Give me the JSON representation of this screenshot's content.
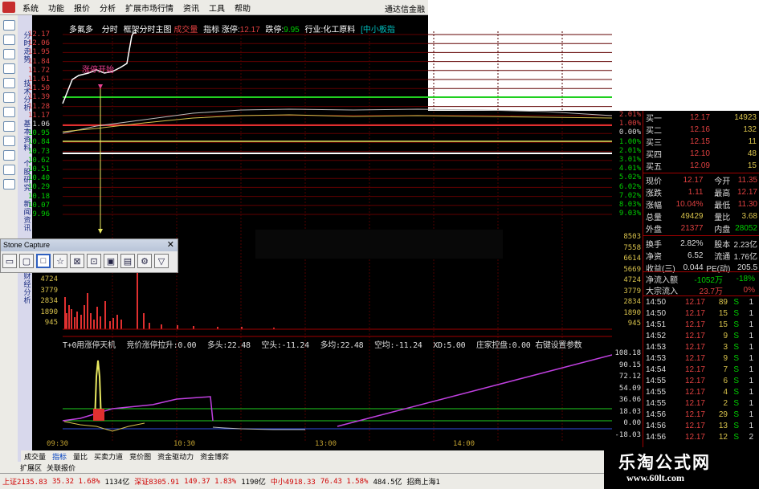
{
  "menu": {
    "items": [
      "系统",
      "功能",
      "报价",
      "分析",
      "扩展市场行情",
      "资讯",
      "工具",
      "帮助"
    ],
    "app_title": "通达信金融"
  },
  "left_tabs": [
    "分时走势",
    "技术分析",
    "基本资料",
    "个股研究",
    "新闻资讯",
    "财经分析"
  ],
  "header": {
    "stock": "多氟多",
    "view": "分时",
    "frame": "框架分时主图",
    "vol_label": "成交量",
    "ind": "指标",
    "limit_up_label": "涨停:",
    "limit_up": "12.17",
    "limit_down_label": "跌停:",
    "limit_down": "9.95",
    "industry": "行业:化工原料",
    "board": "[中小板指"
  },
  "note": "涨停开始",
  "price_axis": [
    "12.17",
    "12.06",
    "11.95",
    "11.84",
    "11.72",
    "11.61",
    "11.50",
    "11.39",
    "11.28",
    "11.17",
    "11.06",
    "10.95",
    "10.84",
    "10.73",
    "10.62",
    "10.51",
    "10.40",
    "10.29",
    "10.18",
    "10.07",
    "9.96"
  ],
  "pct_axis": [
    "2.01%",
    "1.00%",
    "0.00%",
    "1.00%",
    "2.01%",
    "3.01%",
    "4.01%",
    "5.02%",
    "6.02%",
    "7.02%",
    "8.03%",
    "9.03%"
  ],
  "vol_axis": [
    "8503",
    "7558",
    "6614",
    "5669",
    "4724",
    "3779",
    "2834",
    "1890",
    "945"
  ],
  "ind_header": {
    "name": "T+0用涨停天机",
    "items": [
      "竞价涨停拉升:0.00",
      "多头:22.48",
      "空头:-11.24",
      "多均:22.48",
      "空均:-11.24",
      "XD:5.00",
      "庄家控盘:0.00",
      "右键设置参数"
    ]
  },
  "ind_axis": [
    "108.18",
    "90.15",
    "72.12",
    "54.09",
    "36.06",
    "18.03",
    "0.00",
    "-18.03"
  ],
  "time_axis": [
    "09:30",
    "10:30",
    "13:00",
    "14:00"
  ],
  "quote": {
    "bids": [
      {
        "l": "买一",
        "p": "12.17",
        "v": "14923"
      },
      {
        "l": "买二",
        "p": "12.16",
        "v": "132"
      },
      {
        "l": "买三",
        "p": "12.15",
        "v": "11"
      },
      {
        "l": "买四",
        "p": "12.10",
        "v": "48"
      },
      {
        "l": "买五",
        "p": "12.09",
        "v": "15"
      }
    ],
    "stats": [
      {
        "a": "现价",
        "b": "12.17",
        "c": "今开",
        "d": "11.35"
      },
      {
        "a": "涨跌",
        "b": "1.11",
        "c": "最高",
        "d": "12.17"
      },
      {
        "a": "涨幅",
        "b": "10.04%",
        "c": "最低",
        "d": "11.30"
      },
      {
        "a": "总量",
        "b": "49429",
        "c": "量比",
        "d": "3.68"
      },
      {
        "a": "外盘",
        "b": "21377",
        "c": "内盘",
        "d": "28052"
      },
      {
        "a": "换手",
        "b": "2.82%",
        "c": "股本",
        "d": "2.23亿"
      },
      {
        "a": "净资",
        "b": "6.52",
        "c": "流通",
        "d": "1.76亿"
      },
      {
        "a": "收益(三)",
        "b": "0.044",
        "c": "PE(动)",
        "d": "205.5"
      }
    ],
    "flow": [
      {
        "a": "净流入额",
        "b": "-1052万",
        "c": "-18%"
      },
      {
        "a": "大宗流入",
        "b": "23.7万",
        "c": "0%"
      }
    ],
    "ticks": [
      [
        "14:50",
        "12.17",
        "89",
        "S",
        "1"
      ],
      [
        "14:50",
        "12.17",
        "15",
        "S",
        "1"
      ],
      [
        "14:51",
        "12.17",
        "15",
        "S",
        "1"
      ],
      [
        "14:52",
        "12.17",
        "9",
        "S",
        "1"
      ],
      [
        "14:53",
        "12.17",
        "3",
        "S",
        "1"
      ],
      [
        "14:53",
        "12.17",
        "9",
        "S",
        "1"
      ],
      [
        "14:54",
        "12.17",
        "7",
        "S",
        "1"
      ],
      [
        "14:55",
        "12.17",
        "6",
        "S",
        "1"
      ],
      [
        "14:55",
        "12.17",
        "4",
        "S",
        "1"
      ],
      [
        "14:55",
        "12.17",
        "2",
        "S",
        "1"
      ],
      [
        "14:56",
        "12.17",
        "29",
        "S",
        "1"
      ],
      [
        "14:56",
        "12.17",
        "13",
        "S",
        "1"
      ],
      [
        "14:56",
        "12.17",
        "12",
        "S",
        "2"
      ]
    ]
  },
  "stone": {
    "title": "Stone Capture",
    "close": "✕"
  },
  "tabs": [
    "成交量",
    "指标",
    "量比",
    "买卖力道",
    "竞价图",
    "资金驱动力",
    "资金博弈"
  ],
  "subtabs": [
    "扩展区",
    "关联报价"
  ],
  "status": [
    {
      "t": "上证2135.83",
      "c": "r"
    },
    {
      "t": "35.32 1.68%",
      "c": "r"
    },
    {
      "t": "1134亿",
      "c": ""
    },
    {
      "t": "深证8305.91",
      "c": "r"
    },
    {
      "t": "149.37 1.83%",
      "c": "r"
    },
    {
      "t": "1190亿",
      "c": ""
    },
    {
      "t": "中小4918.33",
      "c": "r"
    },
    {
      "t": "76.43 1.58%",
      "c": "r"
    },
    {
      "t": "484.5亿",
      "c": ""
    },
    {
      "t": "招商上海1",
      "c": ""
    }
  ],
  "watermark": {
    "cn": "乐淘公式网",
    "url": "www.60lt.com"
  },
  "colors": {
    "up": "#e04040",
    "down": "#00d000",
    "axis_red": "#a00000"
  }
}
